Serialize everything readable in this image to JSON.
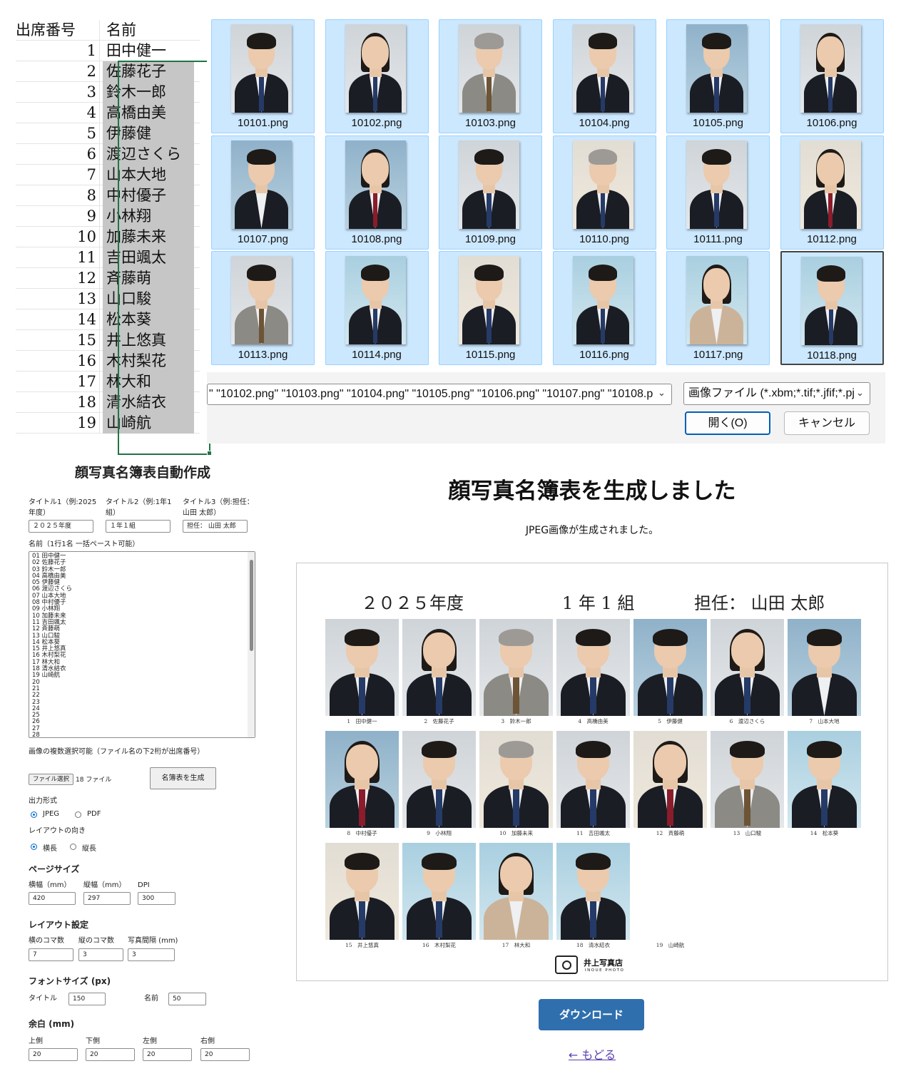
{
  "sheet": {
    "header": {
      "num": "出席番号",
      "name": "名前"
    },
    "rows": [
      {
        "num": "1",
        "name": "田中健一"
      },
      {
        "num": "2",
        "name": "佐藤花子"
      },
      {
        "num": "3",
        "name": "鈴木一郎"
      },
      {
        "num": "4",
        "name": "高橋由美"
      },
      {
        "num": "5",
        "name": "伊藤健"
      },
      {
        "num": "6",
        "name": "渡辺さくら"
      },
      {
        "num": "7",
        "name": "山本大地"
      },
      {
        "num": "8",
        "name": "中村優子"
      },
      {
        "num": "9",
        "name": "小林翔"
      },
      {
        "num": "10",
        "name": "加藤未来"
      },
      {
        "num": "11",
        "name": "吉田颯太"
      },
      {
        "num": "12",
        "name": "斉藤萌"
      },
      {
        "num": "13",
        "name": "山口駿"
      },
      {
        "num": "14",
        "name": "松本葵"
      },
      {
        "num": "15",
        "name": "井上悠真"
      },
      {
        "num": "16",
        "name": "木村梨花"
      },
      {
        "num": "17",
        "name": "林大和"
      },
      {
        "num": "18",
        "name": "清水結衣"
      },
      {
        "num": "19",
        "name": "山崎航"
      }
    ]
  },
  "dialog": {
    "files": [
      "10101.png",
      "10102.png",
      "10103.png",
      "10104.png",
      "10105.png",
      "10106.png",
      "10107.png",
      "10108.png",
      "10109.png",
      "10110.png",
      "10111.png",
      "10112.png",
      "10113.png",
      "10114.png",
      "10115.png",
      "10116.png",
      "10117.png",
      "10118.png"
    ],
    "filename_value": "\" \"10102.png\" \"10103.png\" \"10104.png\" \"10105.png\" \"10106.png\" \"10107.png\" \"10108.p",
    "filter_value": "画像ファイル (*.xbm;*.tif;*.jfif;*.pj",
    "open_label": "開く(O)",
    "cancel_label": "キャンセル"
  },
  "form": {
    "title": "顔写真名簿表自動作成",
    "title1_label": "タイトル1（例:2025年度）",
    "title2_label": "タイトル2（例:1年1組）",
    "title3_label": "タイトル3（例:担任：山田 太郎）",
    "title1_value": "２０２５年度",
    "title2_value": "１年１組",
    "title3_value": "担任： 山田 太郎",
    "names_label": "名前（1行1名 一括ペースト可能）",
    "names_text": "01 田中健一\n02 佐藤花子\n03 鈴木一郎\n04 高橋由美\n05 伊藤健\n06 渡辺さくら\n07 山本大地\n08 中村優子\n09 小林翔\n10 加藤未来\n11 吉田颯太\n12 斉藤萌\n13 山口駿\n14 松本葵\n15 井上悠真\n16 木村梨花\n17 林大和\n18 清水結衣\n19 山崎航\n20\n21\n22\n23\n24\n25\n26\n27\n28",
    "image_note": "画像の複数選択可能（ファイル名の下2桁が出席番号）",
    "file_button": "ファイル選択",
    "file_count": "18 ファイル",
    "generate_button": "名簿表を生成",
    "output_label": "出力形式",
    "output_jpeg": "JPEG",
    "output_pdf": "PDF",
    "orient_label": "レイアウトの向き",
    "orient_landscape": "横長",
    "orient_portrait": "縦長",
    "page_section": "ページサイズ",
    "width_label": "横幅（mm）",
    "height_label": "縦幅（mm）",
    "dpi_label": "DPI",
    "width_value": "420",
    "height_value": "297",
    "dpi_value": "300",
    "layout_section": "レイアウト設定",
    "cols_label": "横のコマ数",
    "rows_label": "縦のコマ数",
    "gap_label": "写真間隔 (mm)",
    "cols_value": "7",
    "rows_value": "3",
    "gap_value": "3",
    "font_section": "フォントサイズ (px)",
    "font_title_label": "タイトル",
    "font_title_value": "150",
    "font_name_label": "名前",
    "font_name_value": "50",
    "margin_section": "余白 (mm)",
    "m_top_label": "上側",
    "m_bottom_label": "下側",
    "m_left_label": "左側",
    "m_right_label": "右側",
    "m_top": "20",
    "m_bottom": "20",
    "m_left": "20",
    "m_right": "20"
  },
  "result": {
    "title": "顔写真名簿表を生成しました",
    "subtitle": "JPEG画像が生成されました。",
    "roster_title1": "２０２５年度",
    "roster_title2": "1 年 1 組",
    "roster_title3": "担任： 山田 太郎",
    "captions": [
      "1　田中健一",
      "2　佐藤花子",
      "3　鈴木一郎",
      "4　高橋由美",
      "5　伊藤健",
      "6　渡辺さくら",
      "7　山本大地",
      "8　中村優子",
      "9　小林翔",
      "10　加藤未来",
      "11　吉田颯太",
      "12　斉藤萌",
      "13　山口駿",
      "14　松本葵",
      "15　井上悠真",
      "16　木村梨花",
      "17　林大和",
      "18　清水結衣",
      "19　山崎航"
    ],
    "studio_name": "井上写真店",
    "studio_sub": "INOUE PHOTO",
    "download_label": "ダウンロード",
    "back_label": "← もどる"
  }
}
